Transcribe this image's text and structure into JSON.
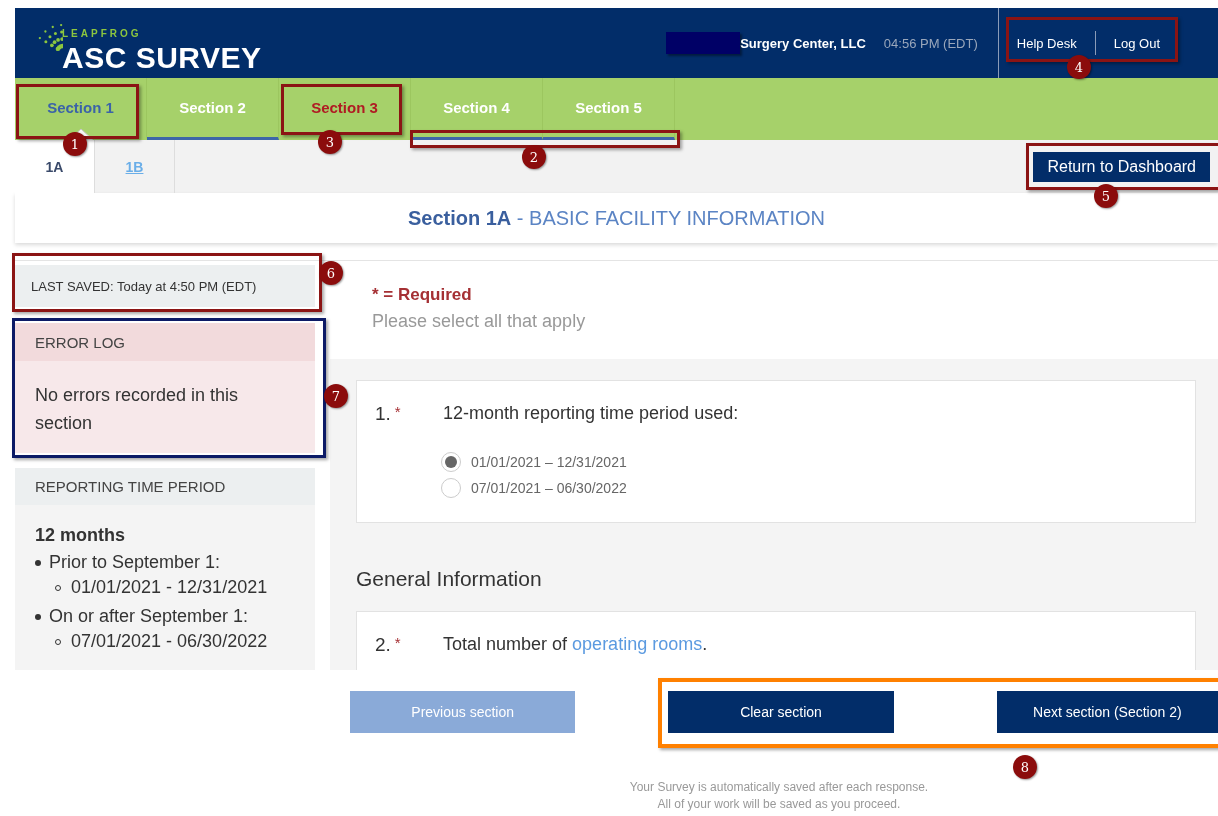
{
  "header": {
    "logo_small": "LEAPFROG",
    "logo_large": "ASC SURVEY",
    "facility": "Surgery Center, LLC",
    "time": "04:56 PM (EDT)",
    "links": [
      "Help Desk",
      "Log Out"
    ]
  },
  "section_tabs": [
    {
      "label": "Section 1",
      "selected": true,
      "error": false,
      "complete": false
    },
    {
      "label": "Section 2",
      "selected": false,
      "error": false,
      "complete": true
    },
    {
      "label": "Section 3",
      "selected": false,
      "error": true,
      "complete": false
    },
    {
      "label": "Section 4",
      "selected": false,
      "error": false,
      "complete": true
    },
    {
      "label": "Section 5",
      "selected": false,
      "error": false,
      "complete": true
    }
  ],
  "sub_tabs": [
    {
      "label": "1A",
      "selected": true
    },
    {
      "label": "1B",
      "selected": false
    }
  ],
  "return_button": "Return to Dashboard",
  "page_title": "**Section 1A** - BASIC FACILITY INFORMATION",
  "sidebar": {
    "last_saved": "LAST SAVED: Today at 4:50 PM (EDT)",
    "error_log": {
      "title": "ERROR LOG",
      "message": "No errors recorded in this section"
    },
    "reporting": {
      "title": "REPORTING TIME PERIOD",
      "heading": "12 months",
      "items": [
        {
          "label": "Prior to September 1:",
          "range": "01/01/2021 - 12/31/2021"
        },
        {
          "label": "On or after September 1:",
          "range": "07/01/2021 - 06/30/2022"
        }
      ]
    }
  },
  "required_note": "* = Required",
  "instruction": "Please select all that apply",
  "questions": [
    {
      "number": "1.",
      "required_mark": "*",
      "text": "12-month reporting time period used:",
      "options": [
        {
          "label": "01/01/2021 – 12/31/2021",
          "selected": true
        },
        {
          "label": "07/01/2021 – 06/30/2022",
          "selected": false
        }
      ]
    }
  ],
  "group_heading": "General Information",
  "question_2": {
    "number": "2.",
    "required_mark": "*",
    "text": "Total number of",
    "link": "operating rooms",
    "suffix": "."
  },
  "buttons": [
    {
      "label": "Previous section",
      "disabled": true
    },
    {
      "label": "Clear section",
      "disabled": false
    },
    {
      "label": "Next section (Section 2)",
      "disabled": false
    }
  ],
  "footer": [
    "Your Survey is automatically saved after each response.",
    "All of your work will be saved as you proceed."
  ],
  "annotations": [
    {
      "number": "1",
      "color": "#8b1414"
    },
    {
      "number": "2",
      "color": "#8b1414"
    },
    {
      "number": "3",
      "color": "#8b1414"
    },
    {
      "number": "4",
      "color": "#8b1414"
    },
    {
      "number": "5",
      "color": "#8b1414"
    },
    {
      "number": "6",
      "color": "#8b1414"
    },
    {
      "number": "7",
      "color": "#0c1a66"
    },
    {
      "number": "8",
      "color": "#ff8000"
    }
  ]
}
